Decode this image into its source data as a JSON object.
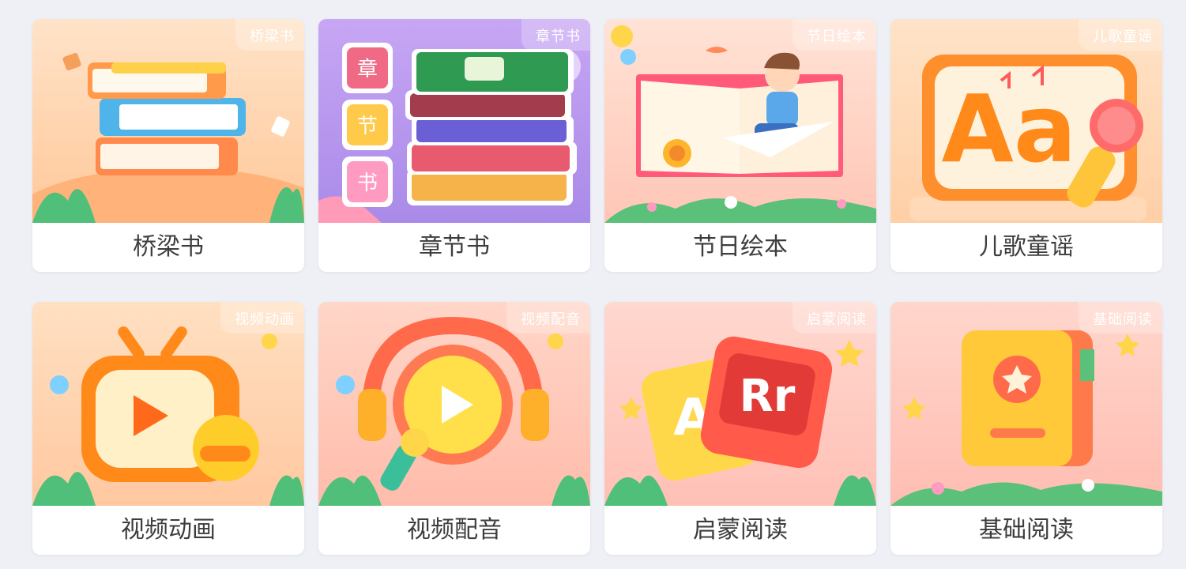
{
  "categories": [
    {
      "title": "桥梁书",
      "tag": "桥梁书",
      "theme": "#ffe0bf",
      "icon": "books-stack-icon"
    },
    {
      "title": "章节书",
      "tag": "章节书",
      "theme": "#c9a8f0",
      "icon": "chapter-books-icon"
    },
    {
      "title": "节日绘本",
      "tag": "节日绘本",
      "theme": "#ffd8cc",
      "icon": "open-book-boy-icon"
    },
    {
      "title": "儿歌童谣",
      "tag": "儿歌童谣",
      "theme": "#ffd9b8",
      "icon": "alphabet-microphone-icon"
    },
    {
      "title": "视频动画",
      "tag": "视频动画",
      "theme": "#ffd5b0",
      "icon": "tv-play-icon"
    },
    {
      "title": "视频配音",
      "tag": "视频配音",
      "theme": "#ffc2b5",
      "icon": "headphone-play-icon"
    },
    {
      "title": "启蒙阅读",
      "tag": "启蒙阅读",
      "theme": "#ffc7c0",
      "icon": "letter-cards-icon"
    },
    {
      "title": "基础阅读",
      "tag": "基础阅读",
      "theme": "#ffc8bf",
      "icon": "star-book-icon"
    }
  ],
  "card2_side_chars": [
    "章",
    "节",
    "书"
  ],
  "card4_letters": "Aa",
  "card7_letters": [
    "A",
    "Rr"
  ]
}
